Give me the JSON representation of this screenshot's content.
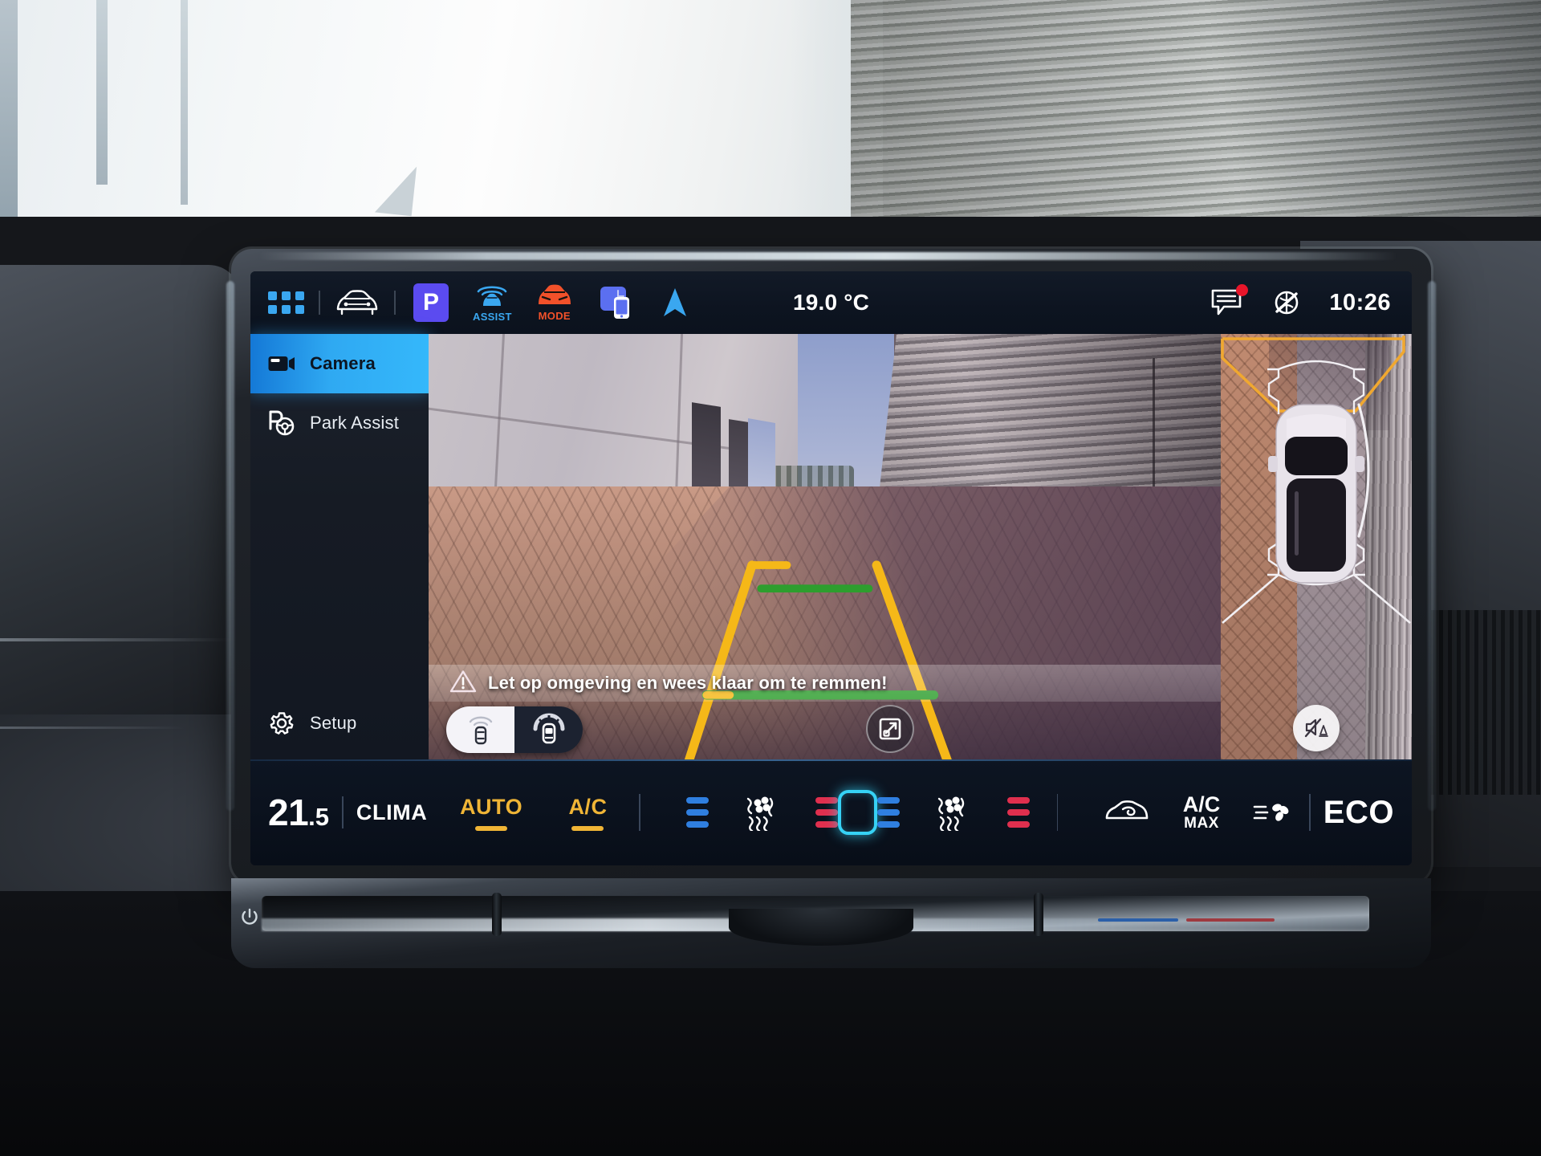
{
  "status_bar": {
    "apps_icon": "app-grid-icon",
    "vehicle_icon": "car-front-icon",
    "park_badge": "P",
    "assist": {
      "icon": "assist-radar-icon",
      "label": "ASSIST"
    },
    "drive_mode": {
      "icon": "car-mode-icon",
      "label": "MODE"
    },
    "phone_icon": "phone-connect-icon",
    "navigation_icon": "navigation-arrow-icon",
    "outside_temperature": "19.0 °C",
    "message_icon": "message-bubble-icon",
    "message_badge": true,
    "mute_icon": "assistant-muted-icon",
    "clock": "10:26",
    "accent_blue": "#3aa7f0",
    "accent_purple": "#5b4bf0",
    "accent_orange": "#f2512a",
    "badge_red": "#e8152a"
  },
  "sidebar": {
    "items": [
      {
        "label": "Camera",
        "icon": "video-camera-icon",
        "active": true
      },
      {
        "label": "Park Assist",
        "icon": "park-steering-icon",
        "active": false
      },
      {
        "label": "Setup",
        "icon": "gear-icon",
        "active": false
      }
    ],
    "active_gradient_from": "#1478d6",
    "active_gradient_to": "#35b8fb"
  },
  "camera_view": {
    "source": "rear-view-camera",
    "warning": {
      "icon": "warning-triangle-icon",
      "text": "Let op omgeving en wees klaar om te remmen!"
    },
    "view_toggle": {
      "options": [
        {
          "icon": "car-rear-sensor-icon",
          "selected": true
        },
        {
          "icon": "car-top-sensor-icon",
          "selected": false
        }
      ]
    },
    "expand_button_icon": "expand-fullscreen-icon",
    "guidelines": {
      "rail_color": "#f5b818",
      "mid_line_color": "#2e9e2e",
      "stop_line_color": "#f11430",
      "description": "Trapezoidal yellow reversing rails with two green distance markers and one red stop line"
    }
  },
  "birdseye_view": {
    "label": "top-down-surround-view",
    "vehicle_color": "#e8e3ea",
    "warning_outline_color": "#f0a830",
    "proximity_arc_color": "#f2f0f4",
    "mute_button_icon": "speaker-muted-icon"
  },
  "climate_bar": {
    "temperature": {
      "whole": "21",
      "fraction": ".5"
    },
    "clima_label": "CLIMA",
    "auto": {
      "label": "AUTO",
      "active": true
    },
    "ac": {
      "label": "A/C",
      "active": true
    },
    "left_seat": {
      "cool_bars": 3,
      "icon": "seat-climate-icon",
      "heat_bars": 3
    },
    "right_seat": {
      "cool_bars": 3,
      "icon": "seat-climate-icon",
      "heat_bars": 3
    },
    "center_button_icon": "climate-center-icon",
    "recirculation_icon": "air-recirculation-icon",
    "ac_max": {
      "line1": "A/C",
      "line2": "MAX"
    },
    "defrost_icon": "rear-defrost-fan-icon",
    "eco_label": "ECO",
    "amber": "#f0b536",
    "cool_blue": "#2f7fe0",
    "heat_red": "#e02f4e",
    "cyan": "#36d2f5"
  },
  "hardware": {
    "power_icon": "power-button-icon",
    "volume_slider": "volume-touch-slider",
    "temp_slider": "temperature-touch-slider"
  }
}
